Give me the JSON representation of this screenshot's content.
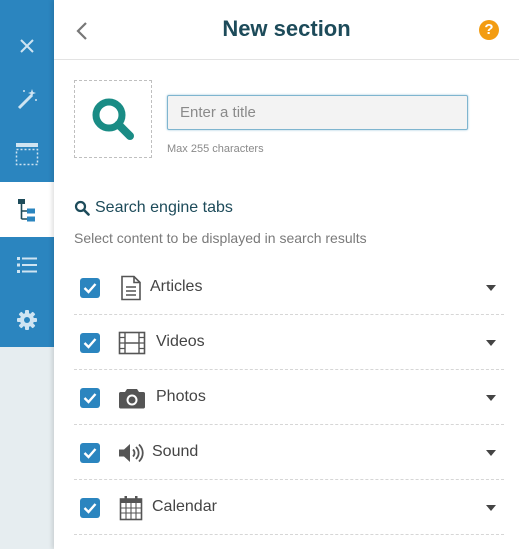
{
  "header": {
    "title": "New section",
    "help_label": "?"
  },
  "title_field": {
    "value": "",
    "placeholder": "Enter a title",
    "hint": "Max 255 characters"
  },
  "search_tabs": {
    "heading": "Search engine tabs",
    "description": "Select content to be displayed in search results",
    "items": [
      {
        "label": "Articles",
        "icon": "document-icon",
        "checked": true
      },
      {
        "label": "Videos",
        "icon": "film-icon",
        "checked": true
      },
      {
        "label": "Photos",
        "icon": "camera-icon",
        "checked": true
      },
      {
        "label": "Sound",
        "icon": "speaker-icon",
        "checked": true
      },
      {
        "label": "Calendar",
        "icon": "calendar-icon",
        "checked": true
      }
    ]
  },
  "rail": {
    "items": [
      "close-icon",
      "magic-wand-icon",
      "layout-icon",
      "tree-icon",
      "list-icon",
      "gear-icon"
    ],
    "active": "tree-icon"
  },
  "colors": {
    "rail_blue": "#2b85bf",
    "title_teal": "#1d4b5a",
    "search_icon_teal": "#1a8c85",
    "help_orange": "#f39c12"
  }
}
